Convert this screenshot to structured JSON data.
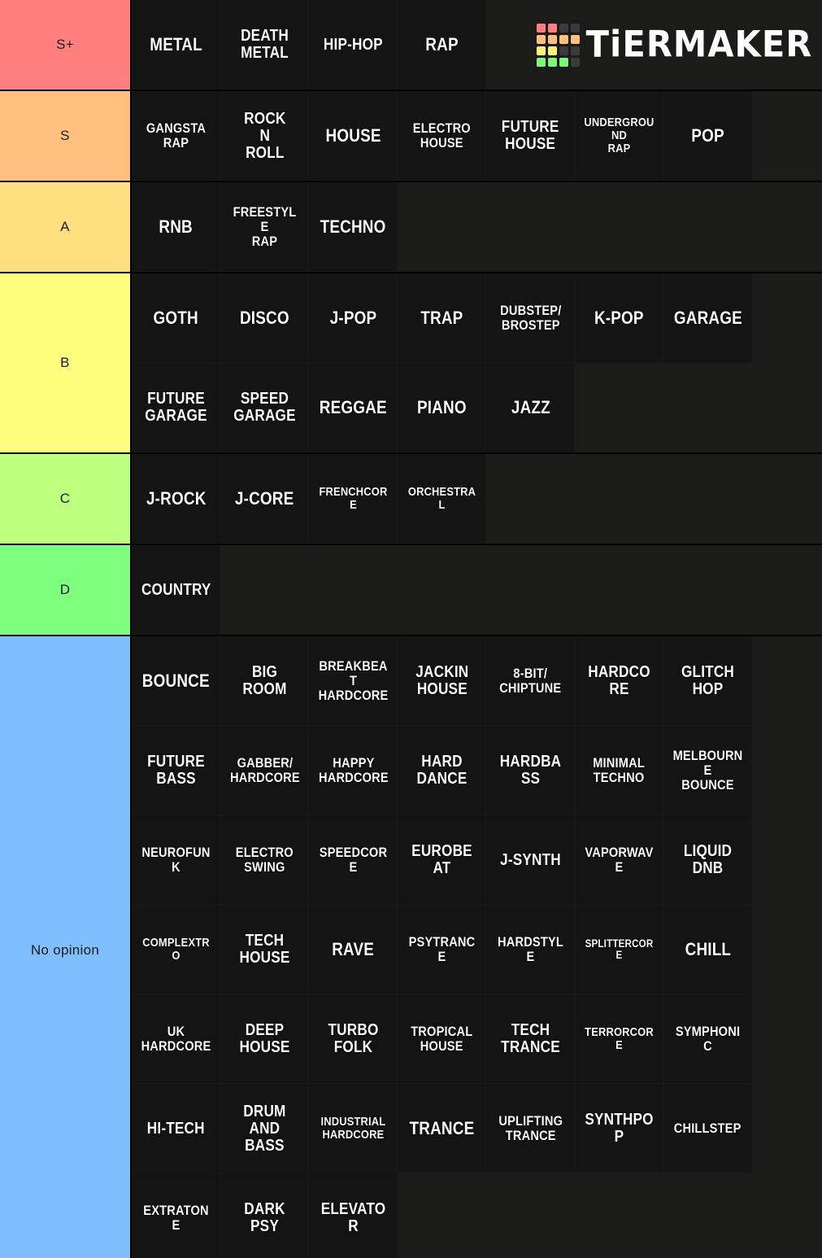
{
  "brand": {
    "name": "TiERMAKER",
    "logo_colors": {
      "red": "#FF7F7F",
      "orange": "#FFBF7F",
      "yellow": "#FFF27F",
      "green": "#7CF77C",
      "empty": "#3a3a3a"
    },
    "logo_grid": [
      [
        "red",
        "red",
        "empty",
        "empty"
      ],
      [
        "orange",
        "orange",
        "orange",
        "orange"
      ],
      [
        "yellow",
        "yellow",
        "empty",
        "empty"
      ],
      [
        "green",
        "green",
        "green",
        "empty"
      ]
    ]
  },
  "tiers": [
    {
      "label": "S+",
      "color": "#FF7F7F",
      "items": [
        "METAL",
        "DEATH METAL",
        "HIP-HOP",
        "RAP"
      ]
    },
    {
      "label": "S",
      "color": "#FFBF7F",
      "items": [
        "GANGSTA RAP",
        "ROCK N ROLL",
        "HOUSE",
        "ELECTRO HOUSE",
        "FUTURE HOUSE",
        "UNDERGROUND RAP",
        "POP"
      ]
    },
    {
      "label": "A",
      "color": "#FFDF7F",
      "items": [
        "RNB",
        "FREESTYLE RAP",
        "TECHNO"
      ]
    },
    {
      "label": "B",
      "color": "#FFFF7F",
      "items": [
        "GOTH",
        "DISCO",
        "J-POP",
        "TRAP",
        "DUBSTEP/ BROSTEP",
        "K-POP",
        "GARAGE",
        "FUTURE GARAGE",
        "SPEED GARAGE",
        "REGGAE",
        "PIANO",
        "JAZZ"
      ]
    },
    {
      "label": "C",
      "color": "#BFFF7F",
      "items": [
        "J-ROCK",
        "J-CORE",
        "FRENCHCORE",
        "ORCHESTRAL"
      ]
    },
    {
      "label": "D",
      "color": "#7FFF7F",
      "items": [
        "COUNTRY"
      ]
    },
    {
      "label": "No opinion",
      "color": "#7FBFFF",
      "items": [
        "BOUNCE",
        "BIG ROOM",
        "BREAKBEAT HARDCORE",
        "JACKIN HOUSE",
        "8-BIT/ CHIPTUNE",
        "HARDCORE",
        "GLITCH HOP",
        "FUTURE BASS",
        "GABBER/ HARDCORE",
        "HAPPY HARDCORE",
        "HARD DANCE",
        "HARDBASS",
        "MINIMAL TECHNO",
        "MELBOURNE BOUNCE",
        "NEUROFUNK",
        "ELECTRO SWING",
        "SPEEDCORE",
        "EUROBEAT",
        "J-SYNTH",
        "VAPORWAVE",
        "LIQUID DNB",
        "COMPLEXTRO",
        "TECH HOUSE",
        "RAVE",
        "PSYTRANCE",
        "HARDSTYLE",
        "SPLITTERCORE",
        "CHILL",
        "UK HARDCORE",
        "DEEP HOUSE",
        "TURBO FOLK",
        "TROPICAL HOUSE",
        "TECH TRANCE",
        "TERRORCORE",
        "SYMPHONIC",
        "HI-TECH",
        "DRUM AND BASS",
        "INDUSTRIAL HARDCORE",
        "TRANCE",
        "UPLIFTING TRANCE",
        "SYNTHPOP",
        "CHILLSTEP",
        "EXTRATONE",
        "DARK PSY",
        "ELEVATOR"
      ]
    }
  ]
}
